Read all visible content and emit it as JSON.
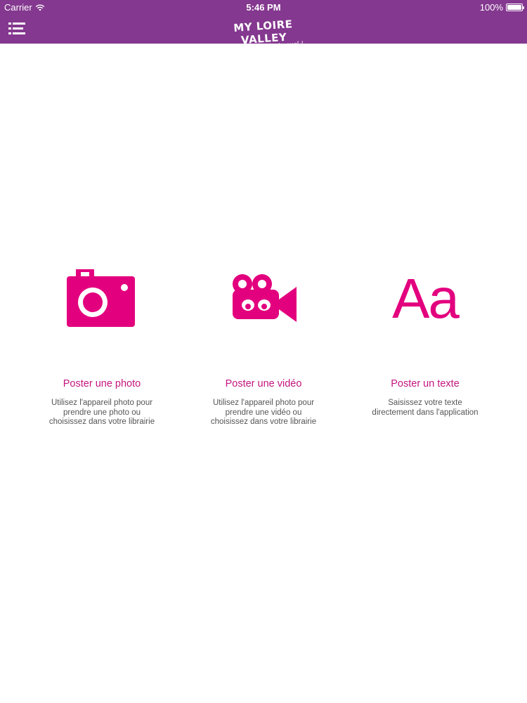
{
  "status_bar": {
    "carrier": "Carrier",
    "time": "5:46 PM",
    "battery": "100%",
    "battery_level": 1.0
  },
  "header": {
    "logo_main": "MY LOIRE VALLEY",
    "logo_sub": "c'est royal !",
    "menu_icon": "menu-list-icon"
  },
  "options": [
    {
      "icon": "camera-icon",
      "title": "Poster une photo",
      "description": "Utilisez l'appareil photo pour prendre une photo ou choisissez dans votre librairie"
    },
    {
      "icon": "video-camera-icon",
      "title": "Poster une vidéo",
      "description": "Utilisez l'appareil photo pour prendre une vidéo ou choisissez dans votre librairie"
    },
    {
      "icon": "text-icon",
      "icon_text": "Aa",
      "title": "Poster un texte",
      "description": "Saisissez votre texte directement dans l'application"
    }
  ],
  "colors": {
    "header": "#84388f",
    "accent": "#e3007e",
    "title": "#c3157f"
  }
}
